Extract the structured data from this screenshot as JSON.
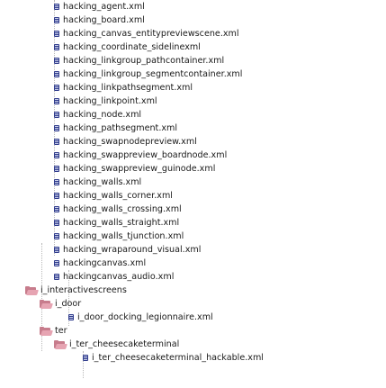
{
  "tree": {
    "files_top": [
      "hacking_agent.xml",
      "hacking_board.xml",
      "hacking_canvas_entitypreviewscene.xml",
      "hacking_coordinate_sidelinexml",
      "hacking_linkgroup_pathcontainer.xml",
      "hacking_linkgroup_segmentcontainer.xml",
      "hacking_linkpathsegment.xml",
      "hacking_linkpoint.xml",
      "hacking_node.xml",
      "hacking_pathsegment.xml",
      "hacking_swapnodepreview.xml",
      "hacking_swappreview_boardnode.xml",
      "hacking_swappreview_guinode.xml",
      "hacking_walls.xml",
      "hacking_walls_corner.xml",
      "hacking_walls_crossing.xml",
      "hacking_walls_straight.xml",
      "hacking_walls_tjunction.xml",
      "hacking_wraparound_visual.xml",
      "hackingcanvas.xml",
      "hackingcanvas_audio.xml"
    ],
    "folder_interactivescreens": "i_interactivescreens",
    "folder_i_door": "i_door",
    "file_i_door_docking": "i_door_docking_legionnaire.xml",
    "folder_ter": "ter",
    "folder_i_ter_cheesecake": "i_ter_cheesecaketerminal",
    "file_i_ter_cheesecake_hackable": "i_ter_cheesecaketerminal_hackable.xml"
  },
  "colors": {
    "file_icon": "#2f3b8c",
    "folder_icon": "#c77c8c",
    "guide_line": "#b8b8b8"
  }
}
